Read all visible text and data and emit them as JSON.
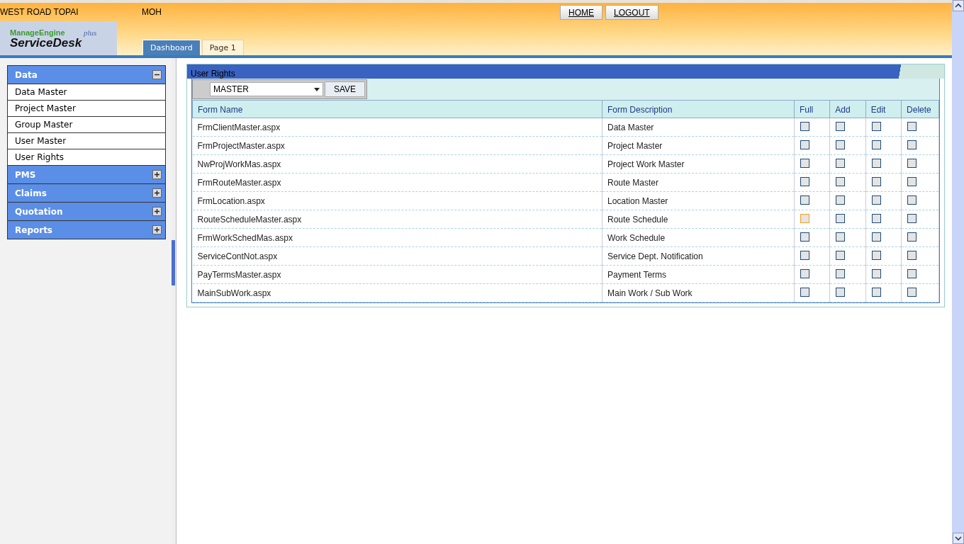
{
  "header": {
    "location": "WEST ROAD TOPAI",
    "user": "MOH",
    "buttons": [
      "HOME",
      "LOGOUT"
    ],
    "logo": {
      "top": "ManageEngine",
      "main": "ServiceDesk",
      "suffix": "plus"
    }
  },
  "tabs": [
    {
      "label": "Dashboard",
      "selected": true
    },
    {
      "label": "Page 1",
      "selected": false
    }
  ],
  "sidebar": {
    "groups": [
      {
        "label": "Data",
        "expanded": true,
        "items": [
          {
            "label": "Data Master"
          },
          {
            "label": "Project Master"
          },
          {
            "label": "Group Master"
          },
          {
            "label": "User Master"
          },
          {
            "label": "User Rights"
          }
        ]
      },
      {
        "label": "PMS",
        "expanded": false
      },
      {
        "label": "Claims",
        "expanded": false
      },
      {
        "label": "Quotation",
        "expanded": false
      },
      {
        "label": "Reports",
        "expanded": false
      }
    ]
  },
  "panel": {
    "title": "User Rights",
    "select": {
      "value": "MASTER"
    },
    "save_button": "SAVE",
    "table": {
      "columns": [
        "Form Name",
        "Form Description",
        "Full",
        "Add",
        "Edit",
        "Delete"
      ],
      "rows": [
        {
          "form_name": "FrmClientMaster.aspx",
          "form_description": "Data Master",
          "rights": [
            {
              "checked": false,
              "focused": false
            },
            {
              "checked": false,
              "focused": false
            },
            {
              "checked": false,
              "focused": false
            },
            {
              "checked": false,
              "focused": false
            }
          ]
        },
        {
          "form_name": "FrmProjectMaster.aspx",
          "form_description": "Project Master",
          "rights": [
            {
              "checked": false,
              "focused": false
            },
            {
              "checked": false,
              "focused": false
            },
            {
              "checked": false,
              "focused": false
            },
            {
              "checked": false,
              "focused": false
            }
          ]
        },
        {
          "form_name": "NwProjWorkMas.aspx",
          "form_description": "Project Work Master",
          "rights": [
            {
              "checked": false,
              "focused": false
            },
            {
              "checked": false,
              "focused": false
            },
            {
              "checked": false,
              "focused": false
            },
            {
              "checked": false,
              "focused": false
            }
          ]
        },
        {
          "form_name": "FrmRouteMaster.aspx",
          "form_description": "Route Master",
          "rights": [
            {
              "checked": false,
              "focused": false
            },
            {
              "checked": false,
              "focused": false
            },
            {
              "checked": false,
              "focused": false
            },
            {
              "checked": false,
              "focused": false
            }
          ]
        },
        {
          "form_name": "FrmLocation.aspx",
          "form_description": "Location Master",
          "rights": [
            {
              "checked": false,
              "focused": false
            },
            {
              "checked": false,
              "focused": false
            },
            {
              "checked": false,
              "focused": false
            },
            {
              "checked": false,
              "focused": false
            }
          ]
        },
        {
          "form_name": "RouteScheduleMaster.aspx",
          "form_description": "Route Schedule",
          "rights": [
            {
              "checked": false,
              "focused": true
            },
            {
              "checked": false,
              "focused": false
            },
            {
              "checked": false,
              "focused": false
            },
            {
              "checked": false,
              "focused": false
            }
          ]
        },
        {
          "form_name": "FrmWorkSchedMas.aspx",
          "form_description": "Work Schedule",
          "rights": [
            {
              "checked": false,
              "focused": false
            },
            {
              "checked": false,
              "focused": false
            },
            {
              "checked": false,
              "focused": false
            },
            {
              "checked": false,
              "focused": false
            }
          ]
        },
        {
          "form_name": "ServiceContNot.aspx",
          "form_description": "Service Dept. Notification",
          "rights": [
            {
              "checked": false,
              "focused": false
            },
            {
              "checked": false,
              "focused": false
            },
            {
              "checked": false,
              "focused": false
            },
            {
              "checked": false,
              "focused": false
            }
          ]
        },
        {
          "form_name": "PayTermsMaster.aspx",
          "form_description": "Payment Terms",
          "rights": [
            {
              "checked": false,
              "focused": false
            },
            {
              "checked": false,
              "focused": false
            },
            {
              "checked": false,
              "focused": false
            },
            {
              "checked": false,
              "focused": false
            }
          ]
        },
        {
          "form_name": "MainSubWork.aspx",
          "form_description": "Main Work / Sub Work",
          "rights": [
            {
              "checked": false,
              "focused": false
            },
            {
              "checked": false,
              "focused": false
            },
            {
              "checked": false,
              "focused": false
            },
            {
              "checked": false,
              "focused": false
            }
          ]
        }
      ]
    }
  }
}
